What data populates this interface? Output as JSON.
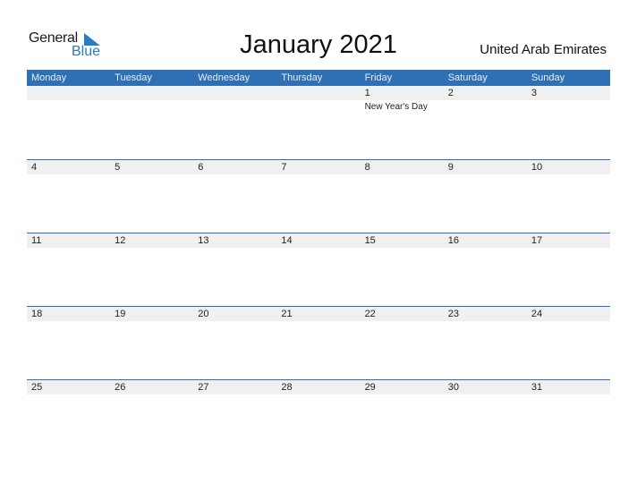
{
  "logo": {
    "general": "General",
    "blue": "Blue"
  },
  "title": "January 2021",
  "country": "United Arab Emirates",
  "weekdays": [
    "Monday",
    "Tuesday",
    "Wednesday",
    "Thursday",
    "Friday",
    "Saturday",
    "Sunday"
  ],
  "weeks": [
    {
      "days": [
        "",
        "",
        "",
        "",
        "1",
        "2",
        "3"
      ],
      "events": [
        "",
        "",
        "",
        "",
        "New Year's Day",
        "",
        ""
      ]
    },
    {
      "days": [
        "4",
        "5",
        "6",
        "7",
        "8",
        "9",
        "10"
      ],
      "events": [
        "",
        "",
        "",
        "",
        "",
        "",
        ""
      ]
    },
    {
      "days": [
        "11",
        "12",
        "13",
        "14",
        "15",
        "16",
        "17"
      ],
      "events": [
        "",
        "",
        "",
        "",
        "",
        "",
        ""
      ]
    },
    {
      "days": [
        "18",
        "19",
        "20",
        "21",
        "22",
        "23",
        "24"
      ],
      "events": [
        "",
        "",
        "",
        "",
        "",
        "",
        ""
      ]
    },
    {
      "days": [
        "25",
        "26",
        "27",
        "28",
        "29",
        "30",
        "31"
      ],
      "events": [
        "",
        "",
        "",
        "",
        "",
        "",
        ""
      ]
    }
  ],
  "colors": {
    "accent": "#2e70b3",
    "row_bg": "#f0f0f0",
    "logo_blue": "#2b7bc4"
  }
}
